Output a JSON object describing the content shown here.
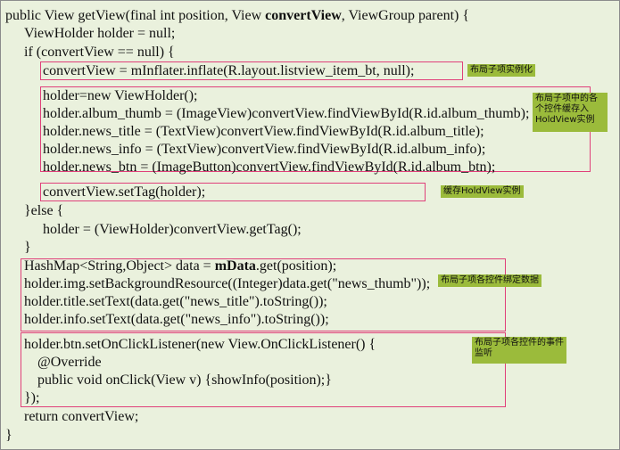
{
  "code": {
    "l01": "public View getView(final int position, View ",
    "l01_bold": "convertView",
    "l01_tail": ", ViewGroup parent) {",
    "l02": "ViewHolder holder = null;",
    "l03": "if (convertView == null) {",
    "l04": "convertView = mInflater.inflate(R.layout.listview_item_bt, null);",
    "l05": "holder=new ViewHolder();",
    "l06": "holder.album_thumb = (ImageView)convertView.findViewById(R.id.album_thumb);",
    "l07": "holder.news_title = (TextView)convertView.findViewById(R.id.album_title);",
    "l08": "holder.news_info = (TextView)convertView.findViewById(R.id.album_info);",
    "l09": "holder.news_btn = (ImageButton)convertView.findViewById(R.id.album_btn);",
    "l10": "convertView.setTag(holder);",
    "l11": "}else {",
    "l12": "holder = (ViewHolder)convertView.getTag();",
    "l13": "}",
    "l14_pre": "HashMap<String,Object> data = ",
    "l14_bold": "mData",
    "l14_tail": ".get(position);",
    "l15": "holder.img.setBackgroundResource((Integer)data.get(\"news_thumb\"));",
    "l16": "holder.title.setText(data.get(\"news_title\").toString());",
    "l17": "holder.info.setText(data.get(\"news_info\").toString());",
    "l18": "holder.btn.setOnClickListener(new View.OnClickListener() {",
    "l19": "@Override",
    "l20": "public void onClick(View v) {showInfo(position);}",
    "l21": "});",
    "l22": "return convertView;",
    "l23": "}"
  },
  "notes": {
    "inflate": "布局子项实例化",
    "holder_store": "布局子项中的各个控件缓存入HoldView实例",
    "cache": "缓存HoldView实例",
    "bind": "布局子项各控件绑定数据",
    "events": "布局子项各控件的事件监听"
  },
  "colors": {
    "slide_bg": "#eaf1dd",
    "highlight_border": "#e0407a",
    "note_bg": "#9bbb3b"
  }
}
